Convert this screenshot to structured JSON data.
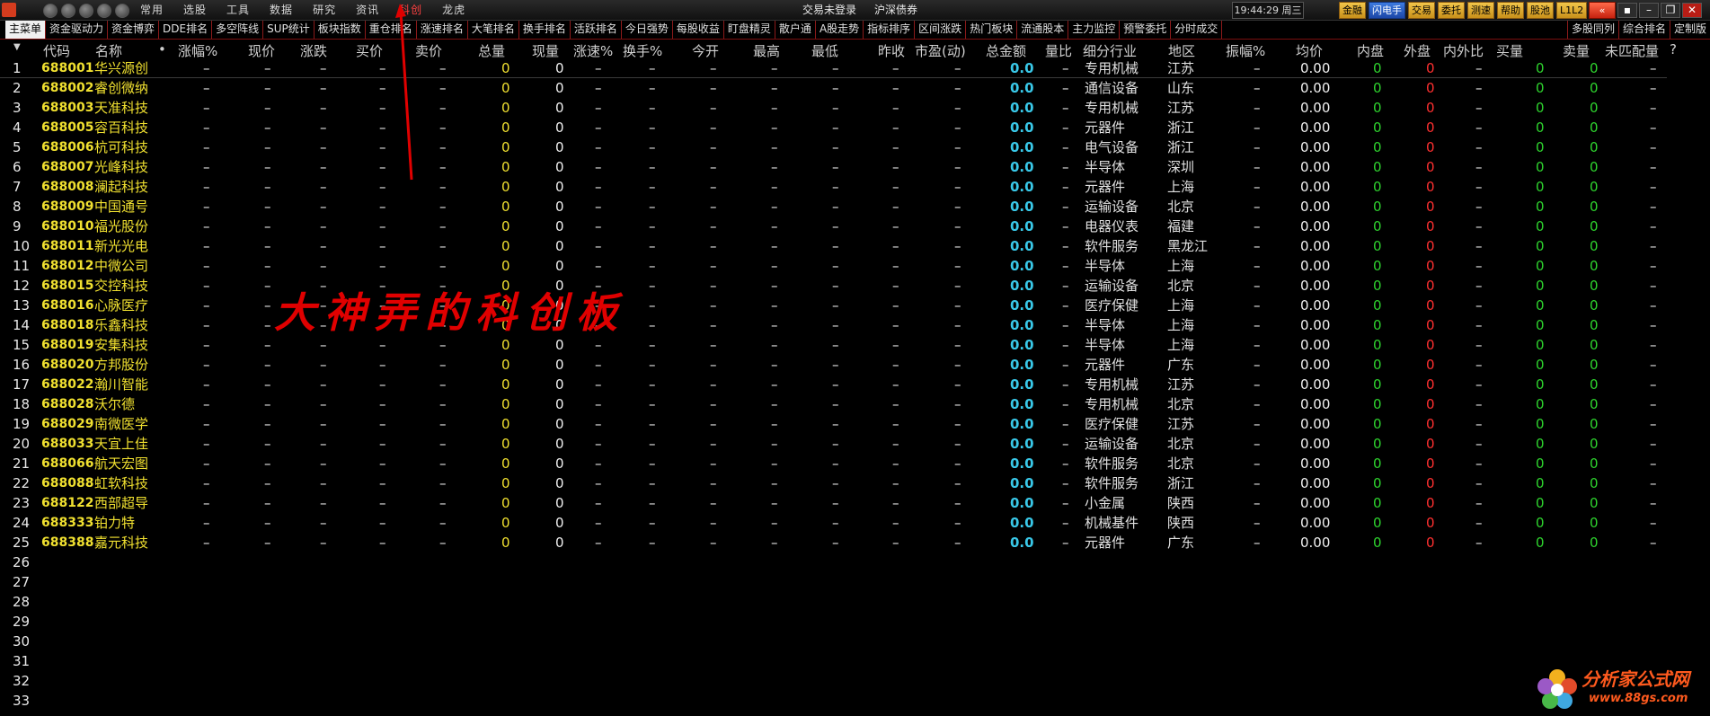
{
  "menu": [
    "常用",
    "选股",
    "工具",
    "数据",
    "研究",
    "资讯",
    "科创",
    "龙虎"
  ],
  "menu_active_index": 6,
  "top_status": {
    "trade": "交易未登录",
    "market": "沪深债券",
    "time": "19:44:29 周三"
  },
  "right_buttons": [
    "金融",
    "闪电手",
    "交易",
    "委托",
    "测速",
    "帮助",
    "股池",
    "L1L2"
  ],
  "tabs": [
    "主菜单",
    "资金驱动力",
    "资金博弈",
    "DDE排名",
    "多空阵线",
    "SUP统计",
    "板块指数",
    "重仓排名",
    "涨速排名",
    "大笔排名",
    "换手排名",
    "活跃排名",
    "今日强势",
    "每股收益",
    "盯盘精灵",
    "散户通",
    "A股走势",
    "指标排序",
    "区间涨跌",
    "热门板块",
    "流通股本",
    "主力监控",
    "预警委托",
    "分时成交"
  ],
  "right_tabs": [
    "多股同列",
    "综合排名",
    "定制版"
  ],
  "columns": [
    "代码",
    "名称",
    "•",
    "涨幅%",
    "现价",
    "涨跌",
    "买价",
    "卖价",
    "总量",
    "现量",
    "涨速%",
    "换手%",
    "今开",
    "最高",
    "最低",
    "昨收",
    "市盈(动)",
    "总金额",
    "量比",
    "细分行业",
    "地区",
    "振幅%",
    "均价",
    "内盘",
    "外盘",
    "内外比",
    "买量",
    "卖量",
    "未匹配量",
    "?"
  ],
  "rows": [
    {
      "code": "688001",
      "name": "华兴源创",
      "industry": "专用机械",
      "region": "江苏"
    },
    {
      "code": "688002",
      "name": "睿创微纳",
      "industry": "通信设备",
      "region": "山东"
    },
    {
      "code": "688003",
      "name": "天准科技",
      "industry": "专用机械",
      "region": "江苏"
    },
    {
      "code": "688005",
      "name": "容百科技",
      "industry": "元器件",
      "region": "浙江"
    },
    {
      "code": "688006",
      "name": "杭可科技",
      "industry": "电气设备",
      "region": "浙江"
    },
    {
      "code": "688007",
      "name": "光峰科技",
      "industry": "半导体",
      "region": "深圳"
    },
    {
      "code": "688008",
      "name": "澜起科技",
      "industry": "元器件",
      "region": "上海"
    },
    {
      "code": "688009",
      "name": "中国通号",
      "industry": "运输设备",
      "region": "北京"
    },
    {
      "code": "688010",
      "name": "福光股份",
      "industry": "电器仪表",
      "region": "福建"
    },
    {
      "code": "688011",
      "name": "新光光电",
      "industry": "软件服务",
      "region": "黑龙江"
    },
    {
      "code": "688012",
      "name": "中微公司",
      "industry": "半导体",
      "region": "上海"
    },
    {
      "code": "688015",
      "name": "交控科技",
      "industry": "运输设备",
      "region": "北京"
    },
    {
      "code": "688016",
      "name": "心脉医疗",
      "industry": "医疗保健",
      "region": "上海"
    },
    {
      "code": "688018",
      "name": "乐鑫科技",
      "industry": "半导体",
      "region": "上海"
    },
    {
      "code": "688019",
      "name": "安集科技",
      "industry": "半导体",
      "region": "上海"
    },
    {
      "code": "688020",
      "name": "方邦股份",
      "industry": "元器件",
      "region": "广东"
    },
    {
      "code": "688022",
      "name": "瀚川智能",
      "industry": "专用机械",
      "region": "江苏"
    },
    {
      "code": "688028",
      "name": "沃尔德",
      "industry": "专用机械",
      "region": "北京"
    },
    {
      "code": "688029",
      "name": "南微医学",
      "industry": "医疗保健",
      "region": "江苏"
    },
    {
      "code": "688033",
      "name": "天宜上佳",
      "industry": "运输设备",
      "region": "北京"
    },
    {
      "code": "688066",
      "name": "航天宏图",
      "industry": "软件服务",
      "region": "北京"
    },
    {
      "code": "688088",
      "name": "虹软科技",
      "industry": "软件服务",
      "region": "浙江"
    },
    {
      "code": "688122",
      "name": "西部超导",
      "industry": "小金属",
      "region": "陕西"
    },
    {
      "code": "688333",
      "name": "铂力特",
      "industry": "机械基件",
      "region": "陕西"
    },
    {
      "code": "688388",
      "name": "嘉元科技",
      "industry": "元器件",
      "region": "广东"
    }
  ],
  "total_row_numbers": 33,
  "values": {
    "dash": "–",
    "zero": "0",
    "zero_amount": "0.0",
    "zero_avg": "0.00"
  },
  "annotation": "大神弄的科创板",
  "watermark": {
    "title": "分析家公式网",
    "url": "www.88gs.com"
  }
}
